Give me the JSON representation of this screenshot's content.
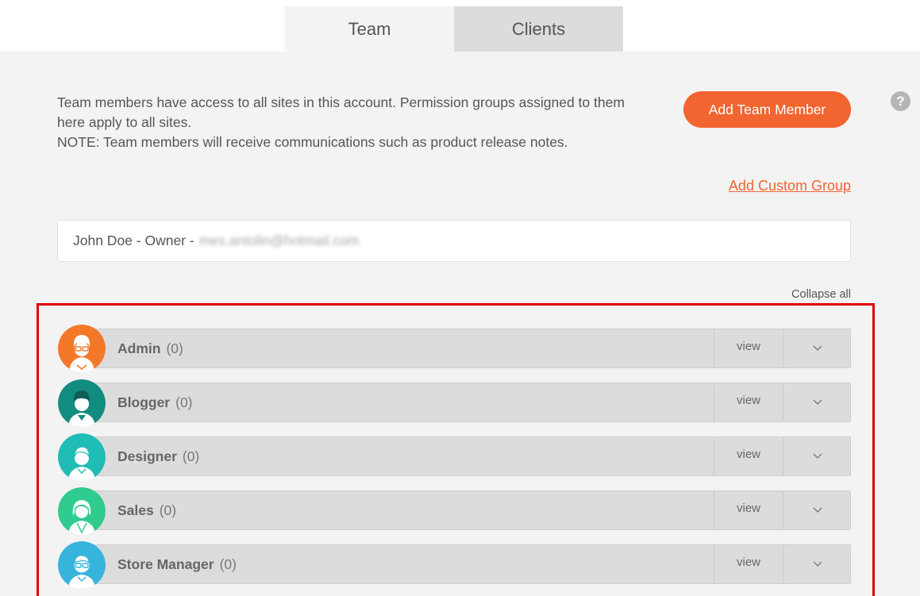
{
  "tabs": {
    "team": "Team",
    "clients": "Clients"
  },
  "intro": {
    "line1": "Team members have access to all sites in this account. Permission groups assigned to them here apply to all sites.",
    "line2": "NOTE: Team members will receive communications such as product release notes."
  },
  "buttons": {
    "add_team_member": "Add Team Member",
    "add_custom_group": "Add Custom Group",
    "collapse_all": "Collapse all",
    "help": "?"
  },
  "owner": {
    "label": "John Doe - Owner -",
    "email": "mes.antolin@hotmail.com"
  },
  "groups": [
    {
      "name": "Admin",
      "count": "(0)",
      "view": "view",
      "avatar": "admin-avatar-icon",
      "color": "#f4782a"
    },
    {
      "name": "Blogger",
      "count": "(0)",
      "view": "view",
      "avatar": "blogger-avatar-icon",
      "color": "#138c80"
    },
    {
      "name": "Designer",
      "count": "(0)",
      "view": "view",
      "avatar": "designer-avatar-icon",
      "color": "#1fbdb5"
    },
    {
      "name": "Sales",
      "count": "(0)",
      "view": "view",
      "avatar": "sales-avatar-icon",
      "color": "#2fcb8f"
    },
    {
      "name": "Store Manager",
      "count": "(0)",
      "view": "view",
      "avatar": "store-manager-avatar-icon",
      "color": "#37b4dc"
    }
  ],
  "colors": {
    "accent": "#f26430",
    "highlight": "#e10000"
  }
}
